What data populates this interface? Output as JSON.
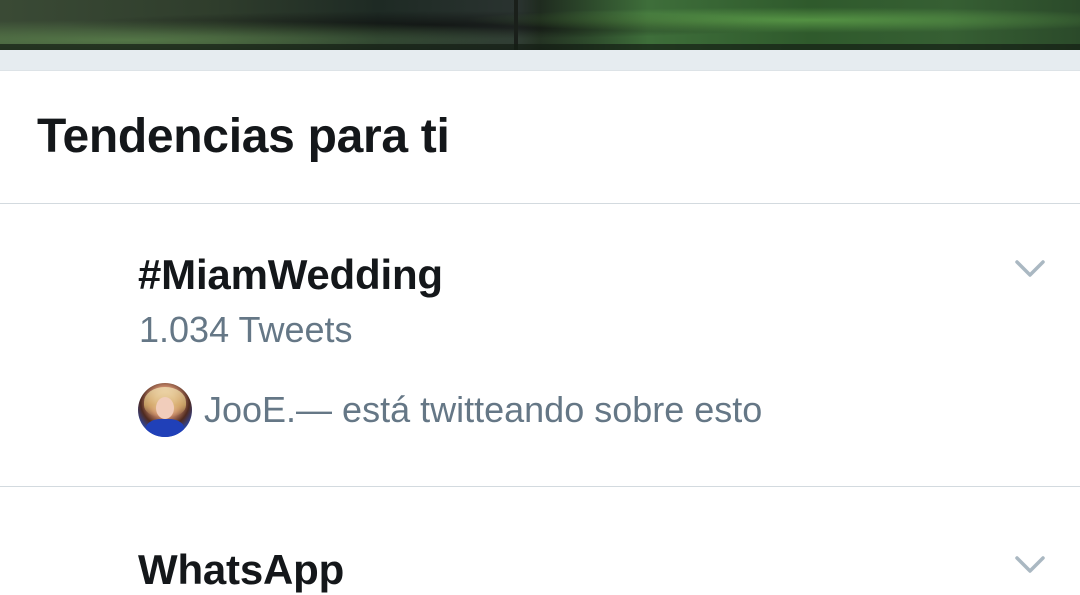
{
  "section": {
    "title": "Tendencias para ti"
  },
  "trends": [
    {
      "name": "#MiamWedding",
      "count": "1.034 Tweets",
      "context": "JooE.— está twitteando sobre esto",
      "menu_icon": "chevron-down-icon"
    },
    {
      "name": "WhatsApp",
      "menu_icon": "chevron-down-icon"
    }
  ],
  "colors": {
    "primary_text": "#14171a",
    "secondary_text": "#657786",
    "divider": "#d3dadf",
    "background_band": "#e6ecf0",
    "chevron": "#aab8c2"
  }
}
